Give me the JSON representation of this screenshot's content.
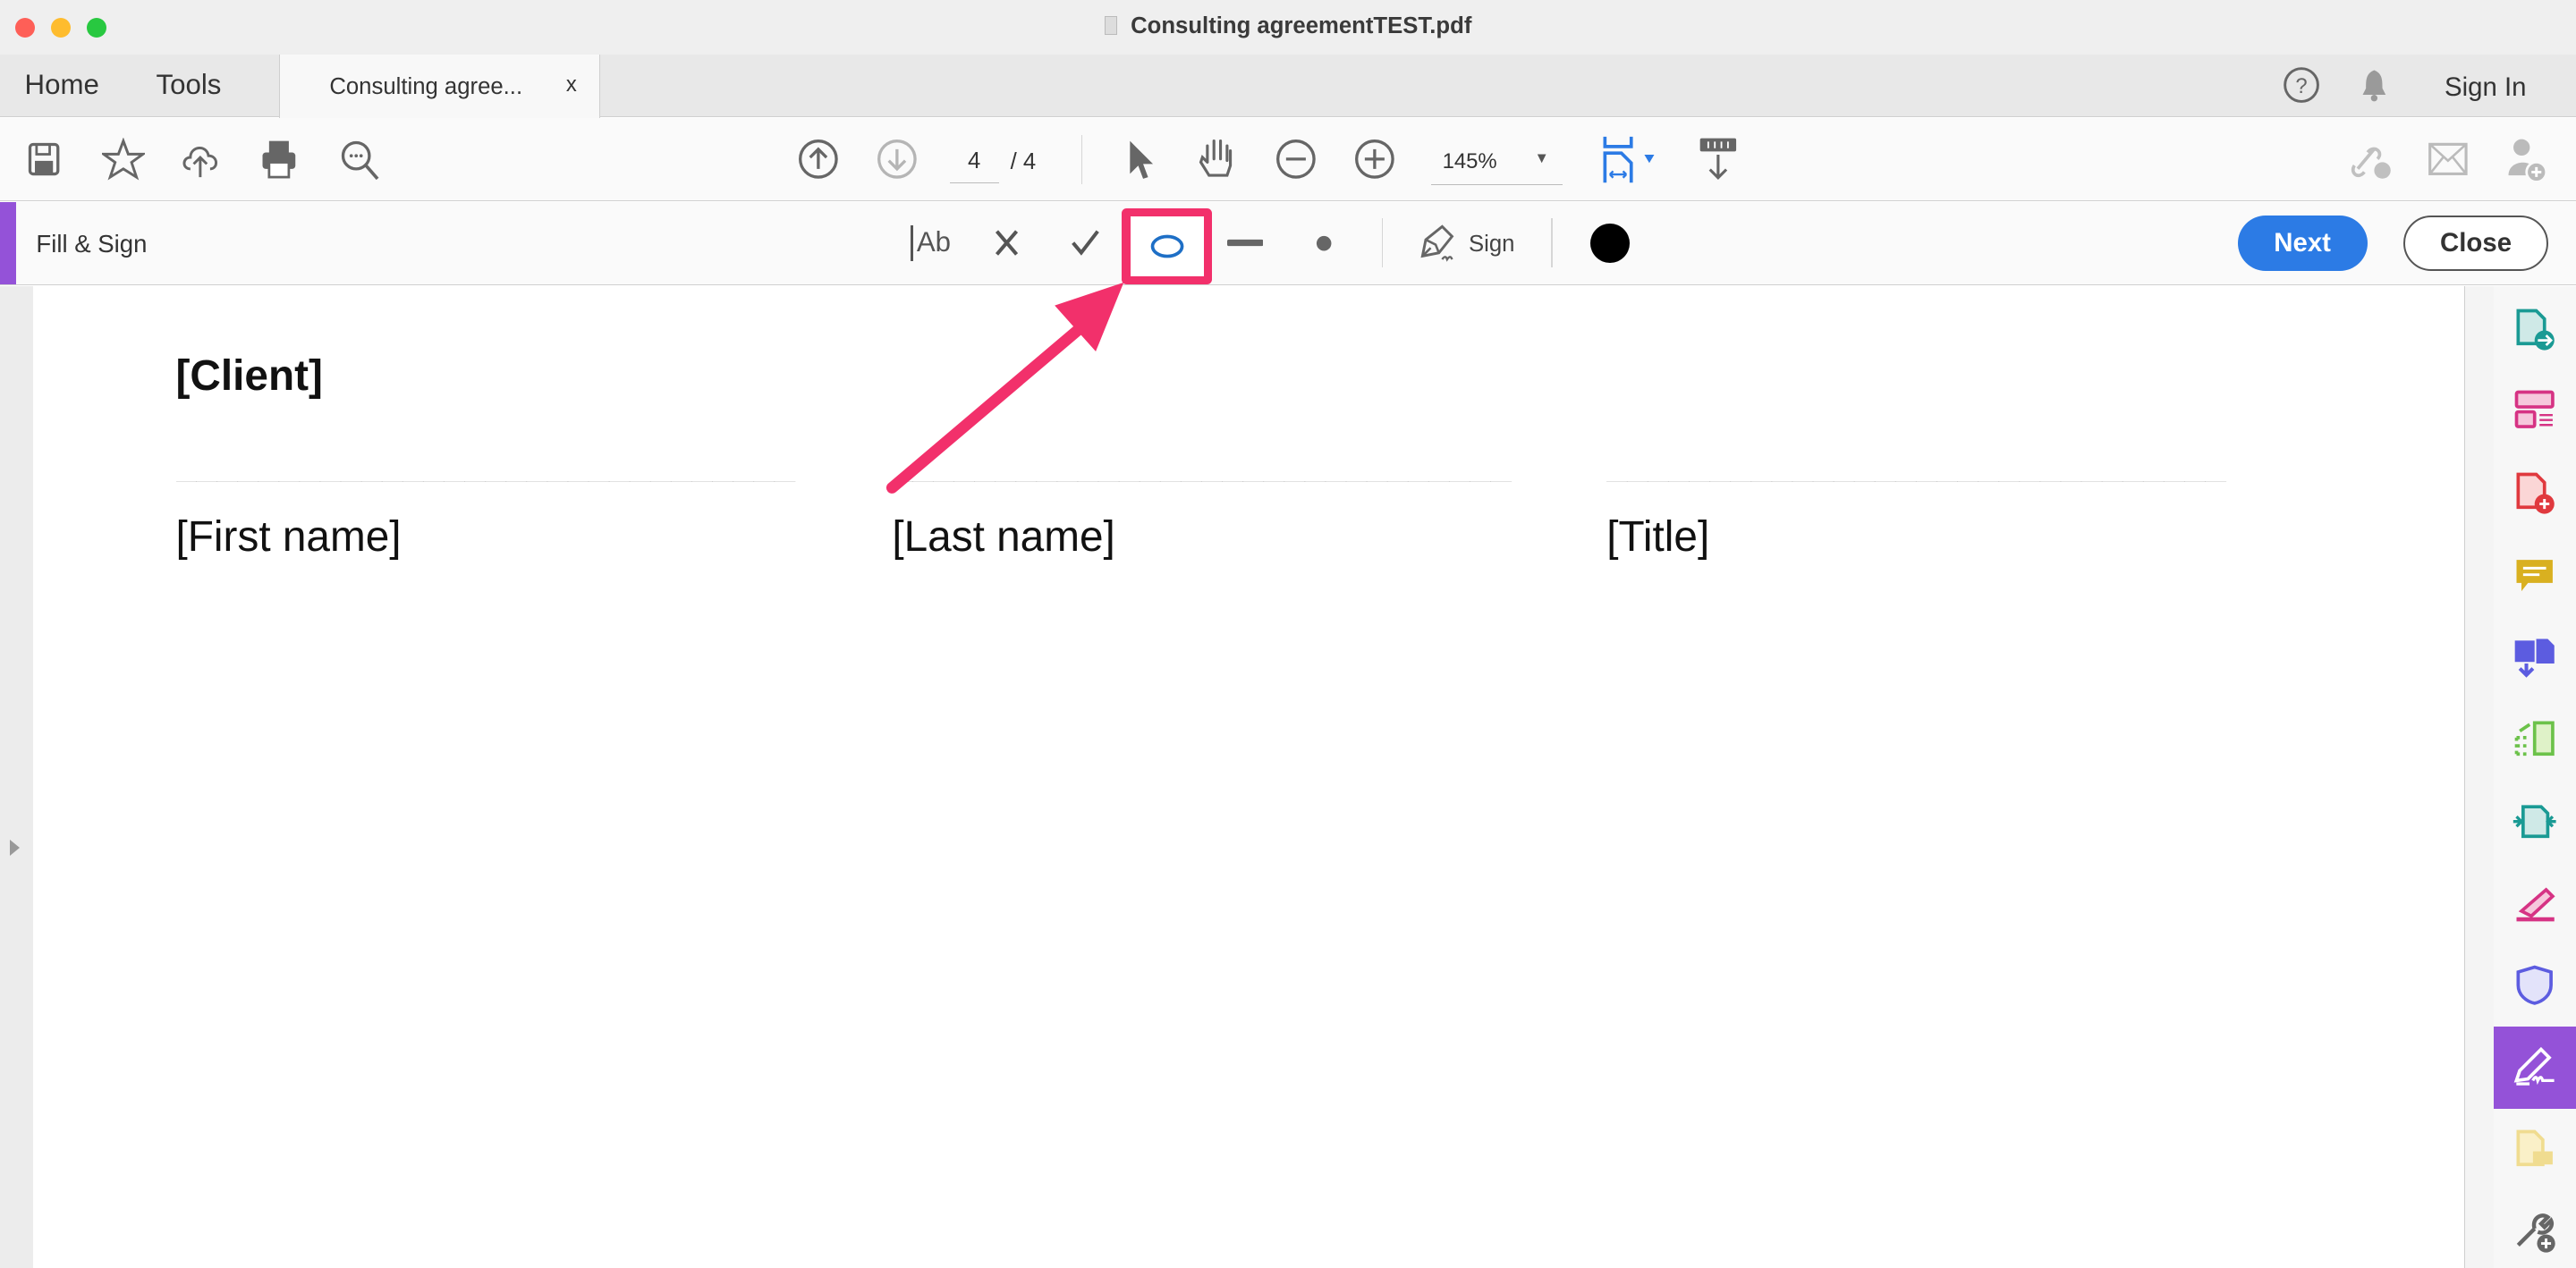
{
  "window": {
    "title": "Consulting agreementTEST.pdf"
  },
  "tabs": {
    "home": "Home",
    "tools": "Tools",
    "document_tab": "Consulting agree...",
    "close_tab": "x",
    "sign_in": "Sign In"
  },
  "toolbar": {
    "current_page": "4",
    "page_total": "/ 4",
    "zoom": "145%"
  },
  "fill_sign": {
    "title": "Fill & Sign",
    "text_tool": "Ab",
    "sign_label": "Sign",
    "next_label": "Next",
    "close_label": "Close",
    "ink_color": "#000000",
    "selected_tool": "ellipse"
  },
  "document": {
    "client": "[Client]",
    "underline": "______________________________",
    "first_name": "[First name]",
    "last_name": "[Last name]",
    "title": "[Title]"
  },
  "colors": {
    "accent": "#2c7be5",
    "fill_sign_purple": "#9452d8",
    "highlight": "#f2306b"
  }
}
